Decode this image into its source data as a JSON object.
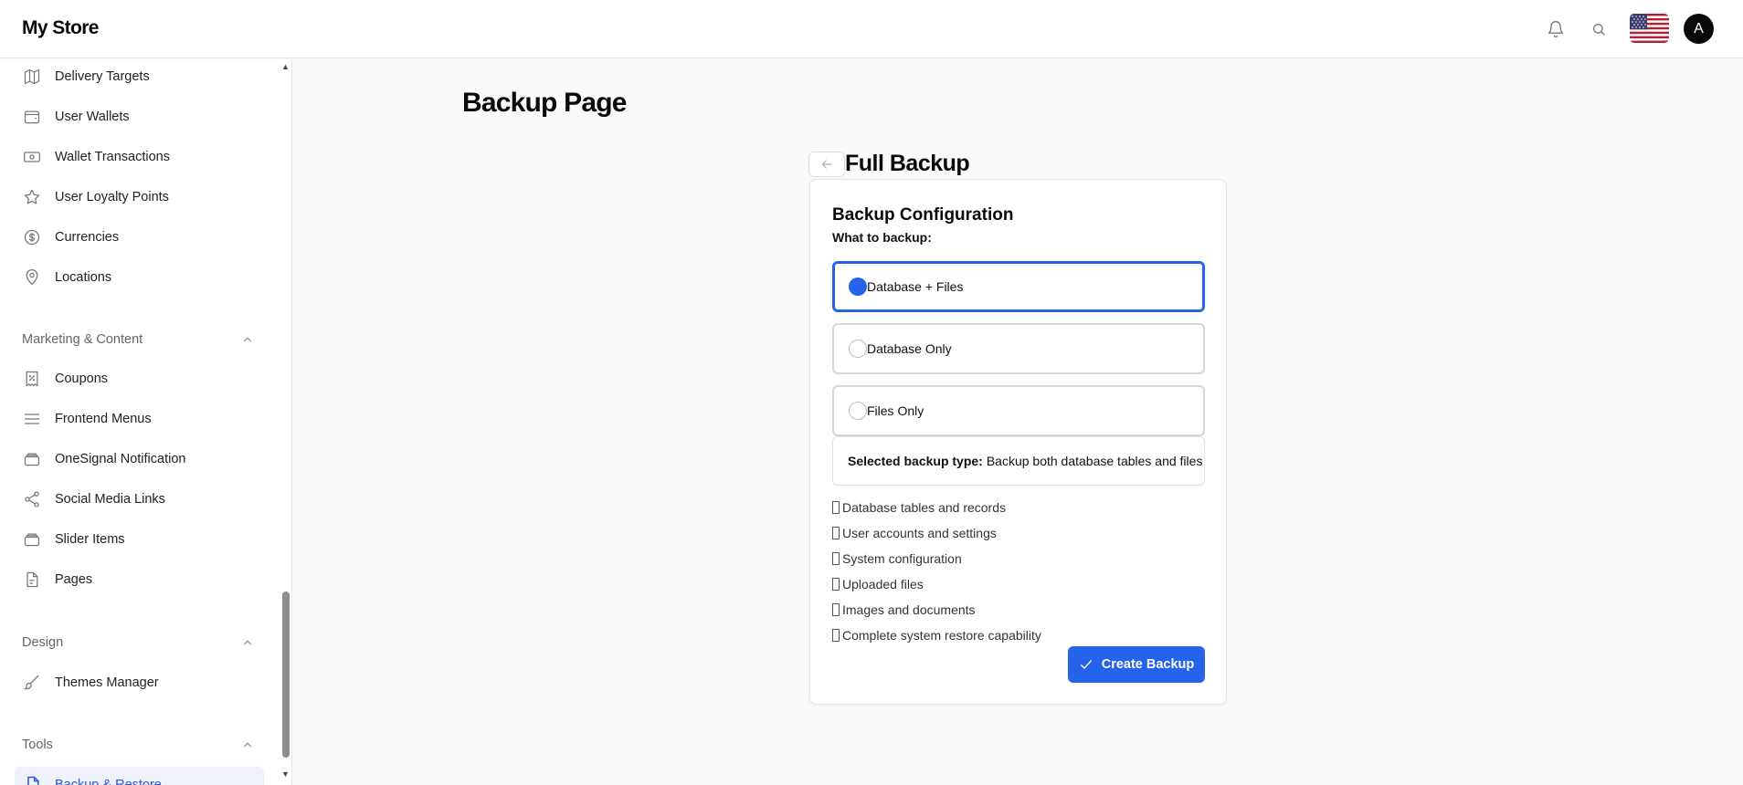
{
  "header": {
    "brand": "My Store",
    "avatar_initial": "A",
    "icons": [
      "bell-icon",
      "search-icon",
      "us-flag-icon"
    ]
  },
  "sidebar": {
    "items_top": [
      {
        "label": "Delivery Targets",
        "icon": "map-icon"
      },
      {
        "label": "User Wallets",
        "icon": "wallet-icon"
      },
      {
        "label": "Wallet Transactions",
        "icon": "banknote-icon"
      },
      {
        "label": "User Loyalty Points",
        "icon": "star-icon"
      },
      {
        "label": "Currencies",
        "icon": "dollar-circle-icon"
      },
      {
        "label": "Locations",
        "icon": "map-pin-icon"
      }
    ],
    "section_marketing": "Marketing & Content",
    "items_marketing": [
      {
        "label": "Coupons",
        "icon": "coupon-icon"
      },
      {
        "label": "Frontend Menus",
        "icon": "menu-icon"
      },
      {
        "label": "OneSignal Notification",
        "icon": "layers-icon"
      },
      {
        "label": "Social Media Links",
        "icon": "share-icon"
      },
      {
        "label": "Slider Items",
        "icon": "layers-icon"
      },
      {
        "label": "Pages",
        "icon": "file-text-icon"
      }
    ],
    "section_design": "Design",
    "items_design": [
      {
        "label": "Themes Manager",
        "icon": "brush-icon"
      }
    ],
    "section_tools": "Tools",
    "active_item": "Backup & Restore"
  },
  "main": {
    "page_title": "Backup Page",
    "card_heading": "Full Backup",
    "card": {
      "title": "Backup Configuration",
      "subtitle": "What to backup:",
      "options": [
        {
          "label": "Database + Files",
          "selected": true
        },
        {
          "label": "Database Only",
          "selected": false
        },
        {
          "label": "Files Only",
          "selected": false
        }
      ],
      "summary_label": "Selected backup type:",
      "summary_value": "Backup both database tables and files",
      "features": [
        "Database tables and records",
        "User accounts and settings",
        "System configuration",
        "Uploaded files",
        "Images and documents",
        "Complete system restore capability"
      ],
      "create_button": "Create Backup"
    }
  },
  "colors": {
    "accent": "#2563eb",
    "active_bg": "#eff2fa",
    "active_text": "#2b56d8"
  }
}
